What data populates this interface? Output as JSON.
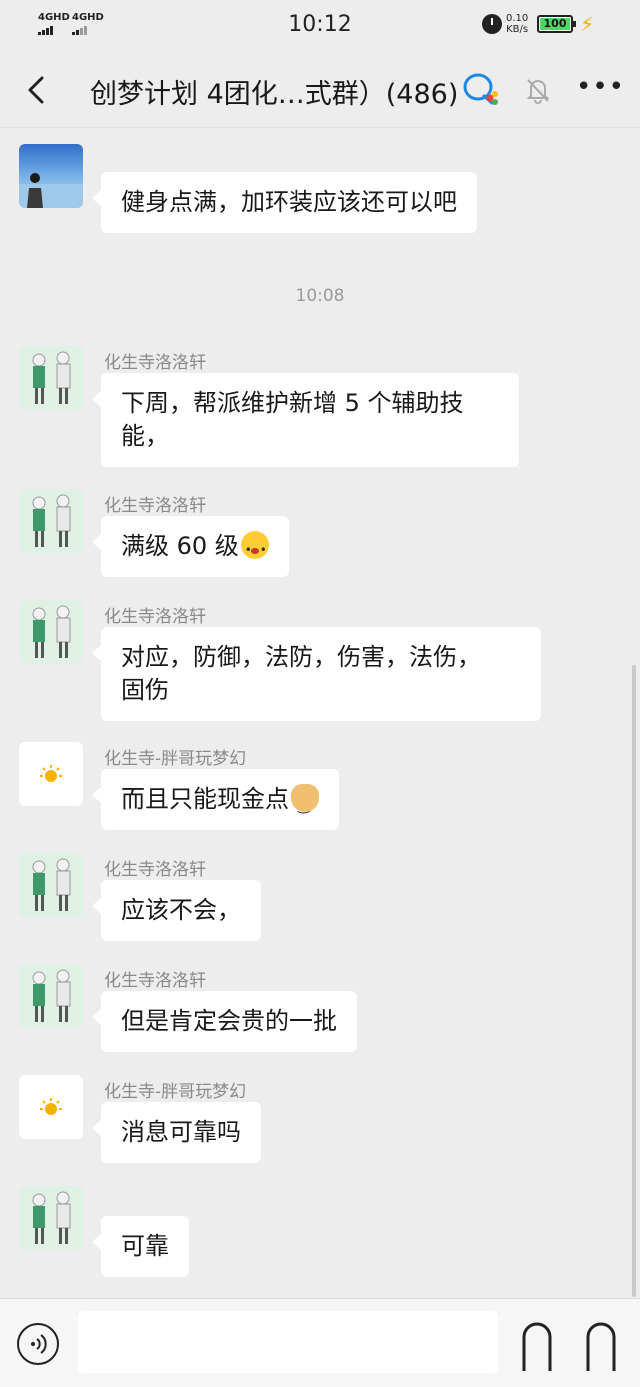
{
  "status_bar": {
    "signal_1": "4GHD",
    "signal_2": "4GHD",
    "time": "10:12",
    "net_speed_value": "0.10",
    "net_speed_unit": "KB/s",
    "battery": "100"
  },
  "header": {
    "title": "创梦计划 4团化…式群）(486)",
    "icons": [
      "back-icon",
      "qq-icon",
      "mute-bell-icon",
      "more-icon"
    ]
  },
  "chat": {
    "messages": [
      {
        "sender": "",
        "avatar": "sea-photo",
        "text": "健身点满，加环装应该还可以吧"
      },
      {
        "timestamp": "10:08"
      },
      {
        "sender": "化生寺洛洛轩",
        "avatar": "couple-illustration",
        "text_lines": [
          "下周，帮派维护新增 5 个辅助技",
          "能，"
        ]
      },
      {
        "sender": "化生寺洛洛轩",
        "avatar": "couple-illustration",
        "text": "满级 60 级",
        "emoji": "flushed-face"
      },
      {
        "sender": "化生寺洛洛轩",
        "avatar": "couple-illustration",
        "text_lines": [
          "对应，防御，法防，伤害，法伤，",
          "固伤"
        ]
      },
      {
        "sender": "化生寺-胖哥玩梦幻",
        "avatar": "sun",
        "text": "而且只能现金点",
        "emoji": "doge-face"
      },
      {
        "sender": "化生寺洛洛轩",
        "avatar": "couple-illustration",
        "text": "应该不会，"
      },
      {
        "sender": "化生寺洛洛轩",
        "avatar": "couple-illustration",
        "text": "但是肯定会贵的一批"
      },
      {
        "sender": "化生寺-胖哥玩梦幻",
        "avatar": "sun",
        "text": "消息可靠吗"
      },
      {
        "sender": "",
        "avatar": "couple-illustration",
        "text": "可靠"
      }
    ]
  },
  "input_bar": {
    "value": "",
    "icons": [
      "voice-icon",
      "emoji-icon",
      "plus-icon"
    ]
  },
  "colors": {
    "background": "#ededed",
    "bubble": "#ffffff",
    "sender_text": "#8a8a8a",
    "battery_fill": "#4cd964",
    "charge_bolt": "#f3b400",
    "qq_blue": "#1e88e5"
  }
}
